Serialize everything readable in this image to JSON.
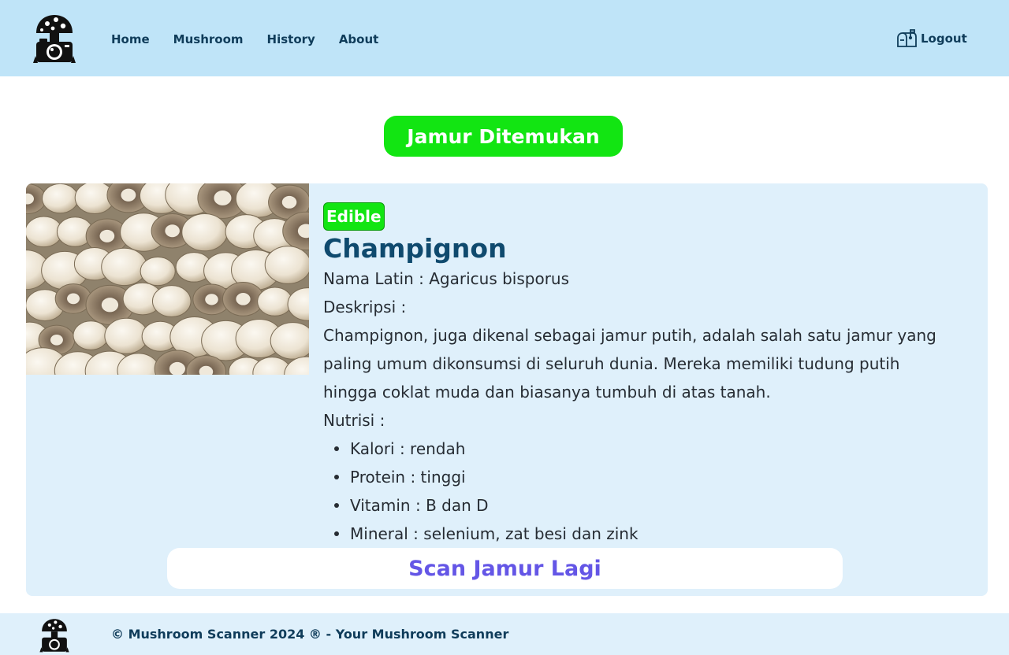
{
  "nav": {
    "logo_icon": "mushroom-camera-logo-icon",
    "links": [
      "Home",
      "Mushroom",
      "History",
      "About"
    ],
    "logout_label": "Logout",
    "logout_icon": "mailbox-icon"
  },
  "banner": {
    "label": "Jamur Ditemukan"
  },
  "result": {
    "badge": "Edible",
    "name": "Champignon",
    "latin_line": "Nama Latin : Agaricus bisporus",
    "desc_heading": "Deskripsi :",
    "description": "Champignon, juga dikenal sebagai jamur putih, adalah salah satu jamur yang paling umum dikonsumsi di seluruh dunia. Mereka memiliki tudung putih hingga coklat muda dan biasanya tumbuh di atas tanah.",
    "nutri_heading": "Nutrisi :",
    "nutrients": [
      "Kalori : rendah",
      "Protein : tinggi",
      "Vitamin : B dan D",
      "Mineral : selenium, zat besi dan zink"
    ],
    "photo_icon": "mushroom-photo"
  },
  "scan_button": {
    "label": "Scan Jamur Lagi"
  },
  "footer": {
    "text": "© Mushroom Scanner 2024 ® - Your Mushroom Scanner"
  },
  "colors": {
    "nav_bg": "#bfe4f8",
    "card_bg": "#dff0fb",
    "green": "#12e512",
    "title_blue": "#0f4a6e",
    "scan_text": "#6456e6"
  }
}
